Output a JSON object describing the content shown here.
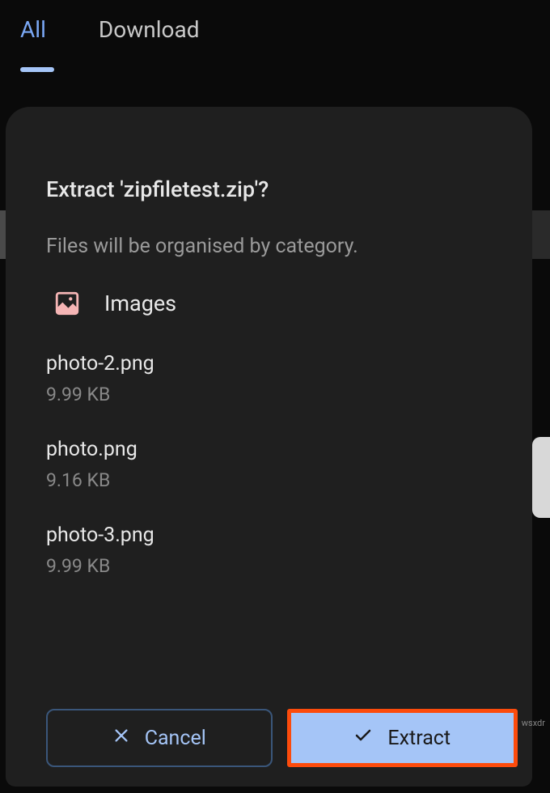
{
  "tabs": {
    "all": "All",
    "download": "Download"
  },
  "dialog": {
    "title": "Extract 'zipfiletest.zip'?",
    "subtitle": "Files will be organised by category.",
    "category": "Images",
    "files": [
      {
        "name": "photo-2.png",
        "size": "9.99 KB"
      },
      {
        "name": "photo.png",
        "size": "9.16 KB"
      },
      {
        "name": "photo-3.png",
        "size": "9.99 KB"
      }
    ],
    "cancel_label": "Cancel",
    "extract_label": "Extract"
  },
  "watermark": "wsxdr"
}
